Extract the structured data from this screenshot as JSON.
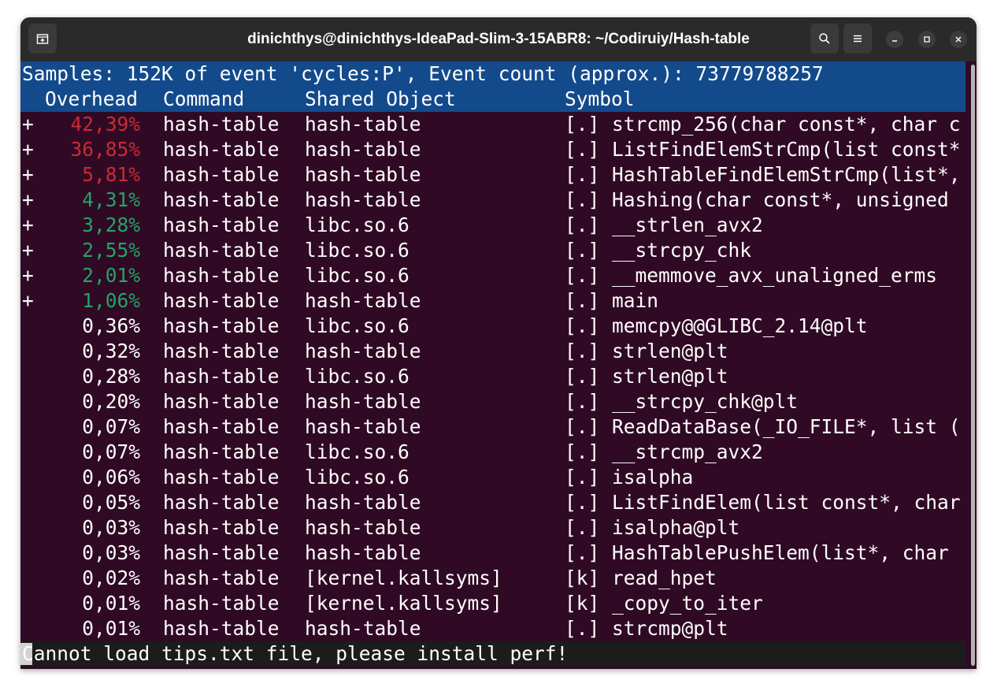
{
  "window": {
    "title": "dinichthys@dinichthys-IdeaPad-Slim-3-15ABR8: ~/Codiruiy/Hash-table"
  },
  "perf": {
    "summary": "Samples: 152K of event 'cycles:P', Event count (approx.): 73779788257",
    "headers": {
      "overhead": "Overhead",
      "command": "Command",
      "shared_object": "Shared Object",
      "symbol": "Symbol"
    },
    "rows": [
      {
        "marker": "+",
        "overhead": "42,39%",
        "color": "#cc2a36",
        "command": "hash-table",
        "object": "hash-table",
        "type": "[.]",
        "symbol": "strcmp_256(char const*, char c"
      },
      {
        "marker": "+",
        "overhead": "36,85%",
        "color": "#cc2a36",
        "command": "hash-table",
        "object": "hash-table",
        "type": "[.]",
        "symbol": "ListFindElemStrCmp(list const*"
      },
      {
        "marker": "+",
        "overhead": "5,81%",
        "color": "#cc2a36",
        "command": "hash-table",
        "object": "hash-table",
        "type": "[.]",
        "symbol": "HashTableFindElemStrCmp(list*,"
      },
      {
        "marker": "+",
        "overhead": "4,31%",
        "color": "#26a269",
        "command": "hash-table",
        "object": "hash-table",
        "type": "[.]",
        "symbol": "Hashing(char const*, unsigned"
      },
      {
        "marker": "+",
        "overhead": "3,28%",
        "color": "#26a269",
        "command": "hash-table",
        "object": "libc.so.6",
        "type": "[.]",
        "symbol": "__strlen_avx2"
      },
      {
        "marker": "+",
        "overhead": "2,55%",
        "color": "#26a269",
        "command": "hash-table",
        "object": "libc.so.6",
        "type": "[.]",
        "symbol": "__strcpy_chk"
      },
      {
        "marker": "+",
        "overhead": "2,01%",
        "color": "#26a269",
        "command": "hash-table",
        "object": "libc.so.6",
        "type": "[.]",
        "symbol": "__memmove_avx_unaligned_erms"
      },
      {
        "marker": "+",
        "overhead": "1,06%",
        "color": "#26a269",
        "command": "hash-table",
        "object": "hash-table",
        "type": "[.]",
        "symbol": "main"
      },
      {
        "marker": "",
        "overhead": "0,36%",
        "color": "#ffffff",
        "command": "hash-table",
        "object": "libc.so.6",
        "type": "[.]",
        "symbol": "memcpy@@GLIBC_2.14@plt"
      },
      {
        "marker": "",
        "overhead": "0,32%",
        "color": "#ffffff",
        "command": "hash-table",
        "object": "hash-table",
        "type": "[.]",
        "symbol": "strlen@plt"
      },
      {
        "marker": "",
        "overhead": "0,28%",
        "color": "#ffffff",
        "command": "hash-table",
        "object": "libc.so.6",
        "type": "[.]",
        "symbol": "strlen@plt"
      },
      {
        "marker": "",
        "overhead": "0,20%",
        "color": "#ffffff",
        "command": "hash-table",
        "object": "hash-table",
        "type": "[.]",
        "symbol": "__strcpy_chk@plt"
      },
      {
        "marker": "",
        "overhead": "0,07%",
        "color": "#ffffff",
        "command": "hash-table",
        "object": "hash-table",
        "type": "[.]",
        "symbol": "ReadDataBase(_IO_FILE*, list ("
      },
      {
        "marker": "",
        "overhead": "0,07%",
        "color": "#ffffff",
        "command": "hash-table",
        "object": "libc.so.6",
        "type": "[.]",
        "symbol": "__strcmp_avx2"
      },
      {
        "marker": "",
        "overhead": "0,06%",
        "color": "#ffffff",
        "command": "hash-table",
        "object": "libc.so.6",
        "type": "[.]",
        "symbol": "isalpha"
      },
      {
        "marker": "",
        "overhead": "0,05%",
        "color": "#ffffff",
        "command": "hash-table",
        "object": "hash-table",
        "type": "[.]",
        "symbol": "ListFindElem(list const*, char"
      },
      {
        "marker": "",
        "overhead": "0,03%",
        "color": "#ffffff",
        "command": "hash-table",
        "object": "hash-table",
        "type": "[.]",
        "symbol": "isalpha@plt"
      },
      {
        "marker": "",
        "overhead": "0,03%",
        "color": "#ffffff",
        "command": "hash-table",
        "object": "hash-table",
        "type": "[.]",
        "symbol": "HashTablePushElem(list*, char"
      },
      {
        "marker": "",
        "overhead": "0,02%",
        "color": "#ffffff",
        "command": "hash-table",
        "object": "[kernel.kallsyms]",
        "type": "[k]",
        "symbol": "read_hpet"
      },
      {
        "marker": "",
        "overhead": "0,01%",
        "color": "#ffffff",
        "command": "hash-table",
        "object": "[kernel.kallsyms]",
        "type": "[k]",
        "symbol": "_copy_to_iter"
      },
      {
        "marker": "",
        "overhead": "0,01%",
        "color": "#ffffff",
        "command": "hash-table",
        "object": "hash-table",
        "type": "[.]",
        "symbol": "strcmp@plt"
      }
    ],
    "status": "Cannot load tips.txt file, please install perf!"
  },
  "colors": {
    "terminal_bg": "#300a24",
    "header_bg": "#134a8c",
    "hot": "#cc2a36",
    "warm": "#26a269",
    "cold": "#ffffff"
  }
}
